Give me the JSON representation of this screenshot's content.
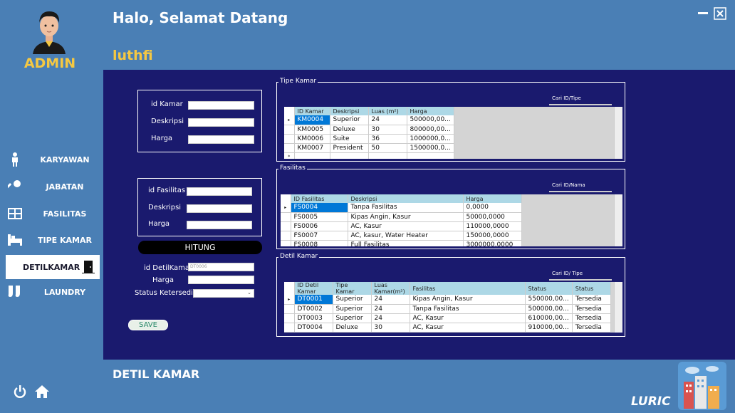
{
  "sidebar": {
    "admin_label": "ADMIN",
    "items": [
      {
        "label": "KARYAWAN",
        "icon": "person-icon"
      },
      {
        "label": "JABATAN",
        "icon": "key-icon"
      },
      {
        "label": "FASILITAS",
        "icon": "grid-icon"
      },
      {
        "label": "TIPE KAMAR",
        "icon": "bed-icon"
      },
      {
        "label": "DETILKAMAR",
        "icon": "door-icon"
      },
      {
        "label": "LAUNDRY",
        "icon": "socks-icon"
      }
    ],
    "active_index": 4
  },
  "header": {
    "greeting": "Halo, Selamat Datang",
    "username": "luthfi"
  },
  "footer": {
    "page_title": "DETIL KAMAR",
    "brand": "LURIC"
  },
  "form_kamar": {
    "id_label": "id Kamar",
    "desc_label": "Deskripsi",
    "price_label": "Harga"
  },
  "form_fasilitas": {
    "id_label": "id Fasilitas",
    "desc_label": "Deskripsi",
    "price_label": "Harga"
  },
  "hitung_label": "HITUNG",
  "form_detil": {
    "id_label": "id DetilKamar",
    "id_value": "DT0006",
    "price_label": "Harga",
    "status_label": "Status Ketersediaan"
  },
  "save_label": "SAVE",
  "tipe_kamar": {
    "title": "Tipe Kamar",
    "search_label": "Cari ID/Tipe",
    "columns": [
      "ID Kamar",
      "Deskripsi",
      "Luas (m²)",
      "Harga"
    ],
    "rows": [
      [
        "KM0004",
        "Superior",
        "24",
        "500000,00..."
      ],
      [
        "KM0005",
        "Deluxe",
        "30",
        "800000,00..."
      ],
      [
        "KM0006",
        "Suite",
        "36",
        "1000000,0..."
      ],
      [
        "KM0007",
        "President",
        "50",
        "1500000,0..."
      ]
    ]
  },
  "fasilitas": {
    "title": "Fasilitas",
    "search_label": "Cari ID/Nama",
    "columns": [
      "ID Fasilitas",
      "Deskripsi",
      "Harga"
    ],
    "rows": [
      [
        "FS0004",
        "Tanpa Fasilitas",
        "0,0000"
      ],
      [
        "FS0005",
        "Kipas Angin, Kasur",
        "50000,0000"
      ],
      [
        "FS0006",
        "AC, Kasur",
        "110000,0000"
      ],
      [
        "FS0007",
        "AC, kasur, Water Heater",
        "150000,0000"
      ],
      [
        "FS0008",
        "Full Fasilitas",
        "3000000,0000"
      ]
    ]
  },
  "detil_kamar": {
    "title": "Detil Kamar",
    "search_label": "Cari ID/ Tipe",
    "columns": [
      "ID Detil Kamar",
      "Tipe Kamar",
      "Luas Kamar(m²)",
      "Fasilitas",
      "Status",
      "Status"
    ],
    "rows": [
      [
        "DT0001",
        "Superior",
        "24",
        "Kipas Angin, Kasur",
        "550000,00...",
        "Tersedia"
      ],
      [
        "DT0002",
        "Superior",
        "24",
        "Tanpa Fasilitas",
        "500000,00...",
        "Tersedia"
      ],
      [
        "DT0003",
        "Superior",
        "24",
        "AC, Kasur",
        "610000,00...",
        "Tersedia"
      ],
      [
        "DT0004",
        "Deluxe",
        "30",
        "AC, Kasur",
        "910000,00...",
        "Tersedia"
      ]
    ]
  }
}
